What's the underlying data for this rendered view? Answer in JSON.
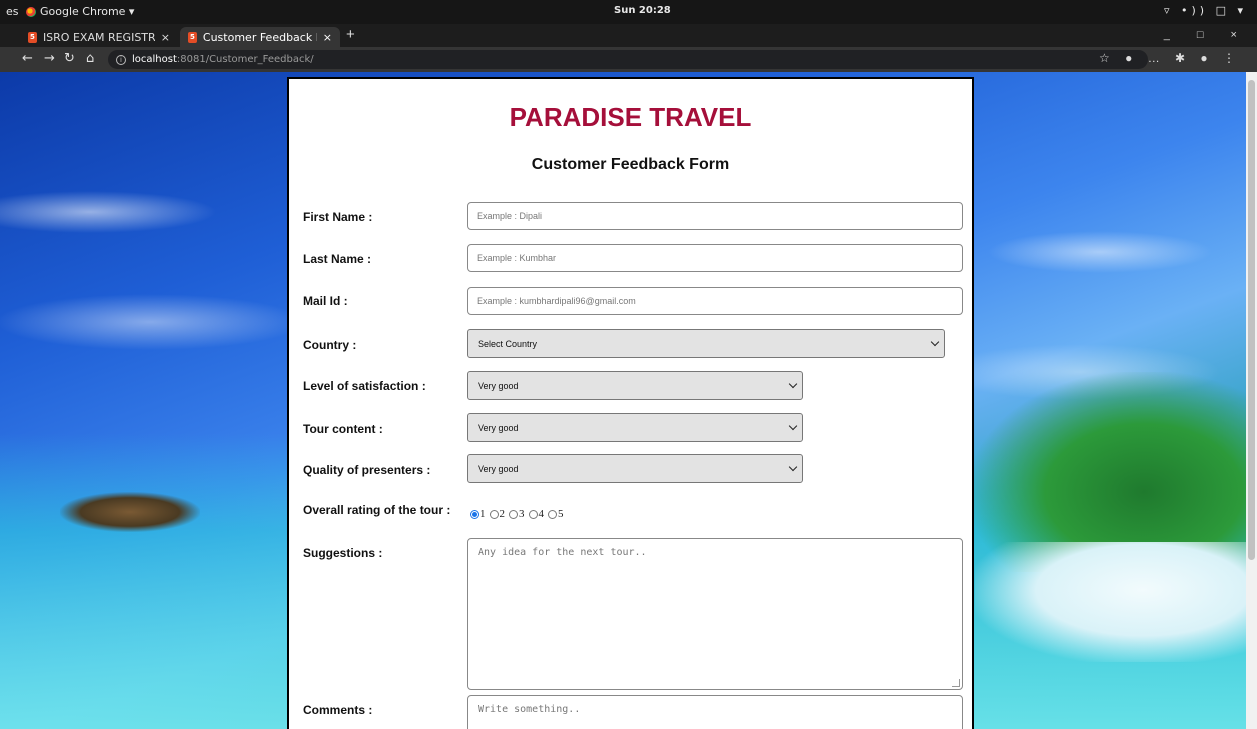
{
  "system": {
    "activities": "es",
    "app_name": "Google Chrome ▾",
    "clock": "Sun 20:28",
    "tray": "▿ •)) □ ▾"
  },
  "browser": {
    "tabs": [
      {
        "label": "ISRO EXAM REGISTRATIO",
        "close": "×"
      },
      {
        "label": "Customer Feedback Form",
        "close": "×"
      }
    ],
    "new_tab": "+",
    "window_controls": "_ □ ×",
    "url_host": "localhost",
    "url_path": ":8081/Customer_Feedback/",
    "toolbar_icons": "☆ ● … ✱ ● ⋮"
  },
  "page": {
    "brand": "PARADISE TRAVEL",
    "subtitle": "Customer Feedback Form",
    "fields": {
      "first_name": {
        "label": "First Name :",
        "placeholder": "Example : Dipali"
      },
      "last_name": {
        "label": "Last Name :",
        "placeholder": "Example : Kumbhar"
      },
      "mail": {
        "label": "Mail Id :",
        "placeholder": "Example : kumbhardipali96@gmail.com"
      },
      "country": {
        "label": "Country :",
        "value": "Select Country"
      },
      "satisfaction": {
        "label": "Level of satisfaction :",
        "value": "Very good"
      },
      "tour_content": {
        "label": "Tour content :",
        "value": "Very good"
      },
      "presenters": {
        "label": "Quality of presenters :",
        "value": "Very good"
      },
      "rating": {
        "label": "Overall rating of the tour :",
        "options": [
          "1",
          "2",
          "3",
          "4",
          "5"
        ],
        "selected": "1"
      },
      "suggestions": {
        "label": "Suggestions :",
        "placeholder": "Any idea for the next tour.."
      },
      "comments": {
        "label": "Comments :",
        "placeholder": "Write something.."
      }
    }
  },
  "colors": {
    "brand": "#a50f3a",
    "radio_selected": "#1a73e8"
  }
}
